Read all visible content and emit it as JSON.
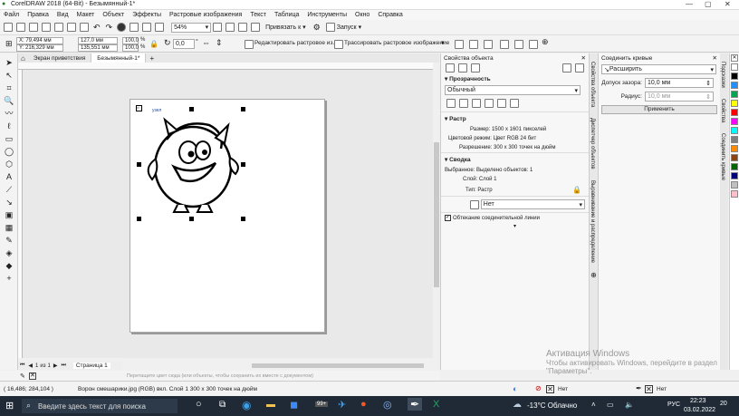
{
  "window": {
    "title": "CorelDRAW 2018 (64-Bit) - Безымянный-1*"
  },
  "menu": [
    "Файл",
    "Правка",
    "Вид",
    "Макет",
    "Объект",
    "Эффекты",
    "Растровые изображения",
    "Текст",
    "Таблица",
    "Инструменты",
    "Окно",
    "Справка"
  ],
  "toolbar1": {
    "zoom": "54%",
    "snap": "Привязать к",
    "launch": "Запуск"
  },
  "toolbar2": {
    "x": "X: 79,494 мм",
    "y": "Y: 216,329 мм",
    "w": "127,0 мм",
    "h": "135,551 мм",
    "sx": "100,0",
    "sy": "100,0",
    "pct": "%",
    "angle": "0,0",
    "angle_unit": "°",
    "edit_bitmap": "Редактировать растровое из...",
    "trace_bitmap": "Трассировать растровое изображение"
  },
  "tabs": [
    "Экран приветствия",
    "Безымянный-1*"
  ],
  "canvas": {
    "label": "узел"
  },
  "pagenav": {
    "pages": "1",
    "of": "из",
    "total": "1",
    "page_tab": "Страница 1"
  },
  "hint": "Перетащите цвет сюда (или объекты, чтобы сохранить их вместе с документом)",
  "object_panel": {
    "title": "Свойства объекта",
    "transparency_title": "Прозрачность",
    "blend_mode": "Обычный",
    "bitmap_title": "Растр",
    "size": "Размер: 1500 x 1601 пикселей",
    "color_mode": "Цветовой режим: Цвет RGB 24 бит",
    "resolution": "Разрешение: 300 x 300 точек на дюйм",
    "summary_title": "Сводка",
    "selected": "Выбранное: Выделено объектов: 1",
    "layer": "Слой: Слой 1",
    "type": "Тип: Растр",
    "wrap_value": "Нет",
    "wrap_text": "Обтекание соединительной линии"
  },
  "dock_tabs": [
    "Свойства объекта",
    "Диспетчер объектов",
    "Выравнивание и распределение"
  ],
  "curve_panel": {
    "title": "Соединить кривые",
    "mode": "Расширить",
    "gap_label": "Допуск зазора:",
    "gap_value": "10,0 мм",
    "radius_label": "Радиус:",
    "radius_value": "10,0 мм",
    "apply": "Применить"
  },
  "right_dock_tabs": [
    "Подсказки",
    "Свойства",
    "Соединить кривые"
  ],
  "status": {
    "coords": "( 16,486; 284,104 )",
    "info": "Ворон смешарики.jpg (RGB) вкл. Слой 1 300 x 300 точек на дюйм",
    "fill": "Нет",
    "outline": "Нет"
  },
  "watermark": {
    "line1": "Активация Windows",
    "line2": "Чтобы активировать Windows, перейдите в раздел",
    "line3": "\"Параметры\"."
  },
  "taskbar": {
    "search": "Введите здесь текст для поиска",
    "weather": "-13°C Облачно",
    "lang": "РУС",
    "time": "22:23",
    "date": "03.02.2022",
    "badge": "99+",
    "notif": "20"
  },
  "palette_colors": [
    "#ffffff",
    "#000000",
    "#1e90ff",
    "#00a651",
    "#ffff00",
    "#ff0000",
    "#ff00ff",
    "#00ffff",
    "#808080",
    "#ff8c00",
    "#8b4513",
    "#006400",
    "#000080",
    "#c0c0c0",
    "#ffc0cb"
  ]
}
